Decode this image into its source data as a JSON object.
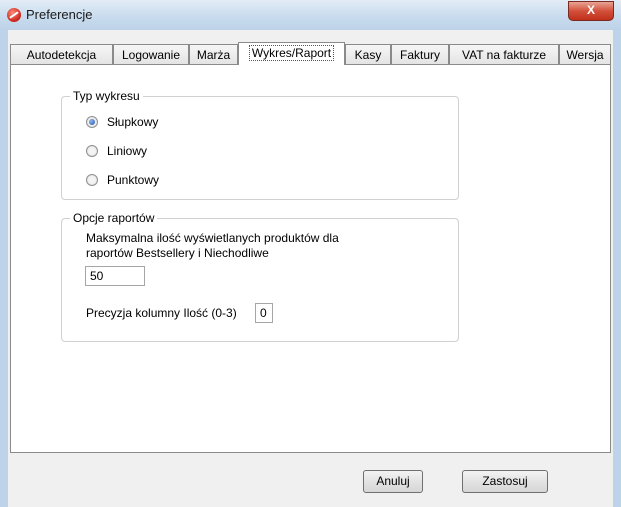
{
  "window": {
    "title": "Preferencje",
    "close_glyph": "X"
  },
  "tabs": [
    {
      "label": "Autodetekcja"
    },
    {
      "label": "Logowanie"
    },
    {
      "label": "Marża"
    },
    {
      "label": "Wykres/Raport",
      "active": true
    },
    {
      "label": "Kasy"
    },
    {
      "label": "Faktury"
    },
    {
      "label": "VAT na fakturze"
    },
    {
      "label": "Wersja"
    }
  ],
  "chart_type_group": {
    "title": "Typ wykresu",
    "options": [
      {
        "label": "Słupkowy",
        "checked": true
      },
      {
        "label": "Liniowy",
        "checked": false
      },
      {
        "label": "Punktowy",
        "checked": false
      }
    ]
  },
  "report_group": {
    "title": "Opcje raportów",
    "max_products_label_line1": "Maksymalna ilość wyświetlanych produktów dla",
    "max_products_label_line2": "raportów Bestsellery i Niechodliwe",
    "max_products_value": "50",
    "precision_label": "Precyzja kolumny Ilość (0-3)",
    "precision_value": "0"
  },
  "buttons": {
    "cancel": "Anuluj",
    "apply": "Zastosuj"
  }
}
